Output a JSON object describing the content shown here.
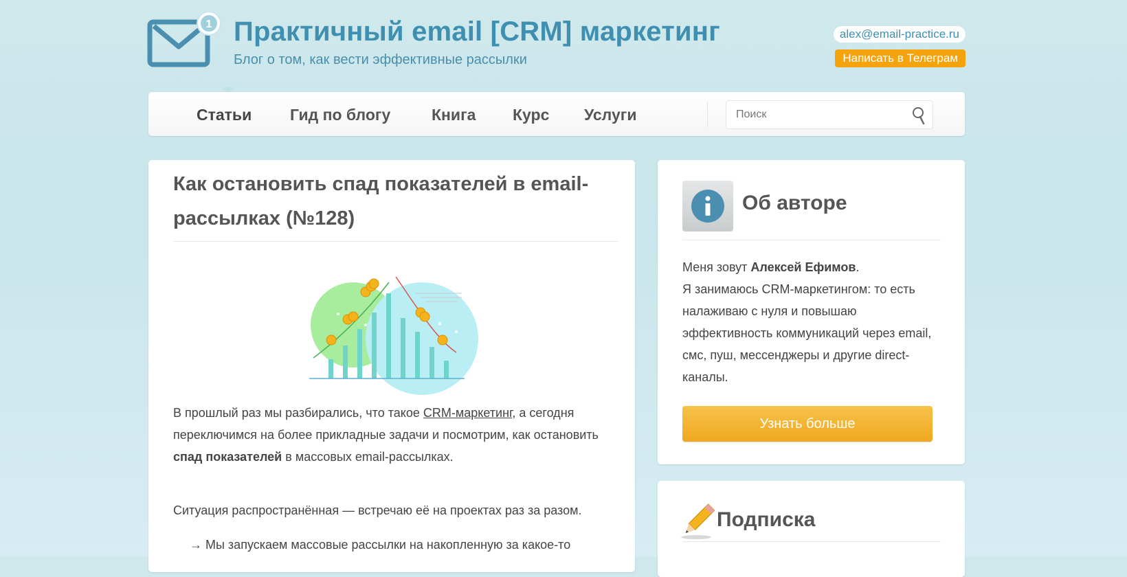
{
  "header": {
    "title": "Практичный email [CRM] маркетинг",
    "subtitle": "Блог о том, как вести эффективные рассылки",
    "email": "alex@email-practice.ru",
    "telegram_button": "Написать в Телеграм",
    "logo_badge": "1",
    "brand_color": "#3f8fb0",
    "accent_color": "#f5a30c"
  },
  "nav": {
    "items": [
      {
        "label": "Статьи",
        "active": true
      },
      {
        "label": "Гид по блогу",
        "active": false
      },
      {
        "label": "Книга",
        "active": false
      },
      {
        "label": "Курс",
        "active": false
      },
      {
        "label": "Услуги",
        "active": false
      }
    ],
    "search_placeholder": "Поиск",
    "search_icon": "search-icon"
  },
  "article": {
    "title": "Как остановить спад показателей в email-рассылках (№128)",
    "p1_before": "В прошлый раз мы разбирались, что такое ",
    "p1_link": "CRM-маркетинг",
    "p1_middle": ", а сегодня переключимся на более прикладные задачи и посмотрим, как остановить ",
    "p1_bold": "спад показателей",
    "p1_after": " в массовых email-рассылках.",
    "p2": "Ситуация распространённая — встречаю её на проектах раз за разом.",
    "p3": "→ Мы запускаем массовые рассылки на накопленную за какое-то"
  },
  "sidebar": {
    "about_title": "Об авторе",
    "about_icon": "info-icon",
    "about_intro": "Меня зовут ",
    "about_name": "Алексей Ефимов",
    "about_dot": ".",
    "about_text": "Я занимаюсь CRM-маркетингом: то есть налаживаю с нуля и повышаю эффективность коммуникаций через email, смс, пуш, мессенджеры и другие direct-каналы.",
    "more_button": "Узнать больше",
    "subscribe_title": "Подписка",
    "subscribe_icon": "pencil-icon"
  }
}
